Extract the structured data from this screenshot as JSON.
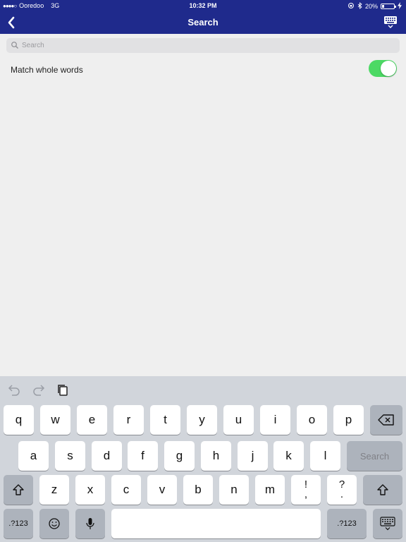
{
  "status_bar": {
    "signal": "●●●●○",
    "carrier": "Ooredoo",
    "network": "3G",
    "time": "10:32 PM",
    "battery_text": "20%",
    "battery_level": 0.2
  },
  "nav": {
    "title": "Search"
  },
  "search": {
    "placeholder": "Search",
    "value": ""
  },
  "options": {
    "match_whole_words": {
      "label": "Match whole words",
      "enabled": true
    }
  },
  "keyboard": {
    "row1": [
      "q",
      "w",
      "e",
      "r",
      "t",
      "y",
      "u",
      "i",
      "o",
      "p"
    ],
    "row2": [
      "a",
      "s",
      "d",
      "f",
      "g",
      "h",
      "j",
      "k",
      "l"
    ],
    "row3": [
      "z",
      "x",
      "c",
      "v",
      "b",
      "n",
      "m"
    ],
    "punct_1": {
      "top": "!",
      "bottom": ","
    },
    "punct_2": {
      "top": "?",
      "bottom": "."
    },
    "return_label": "Search",
    "numbers_label": ".?123",
    "numbers_label_right": ".?123"
  },
  "colors": {
    "nav_bg": "#1f2a8c",
    "toggle_on": "#4cd964",
    "keyboard_bg": "#d1d5db"
  }
}
